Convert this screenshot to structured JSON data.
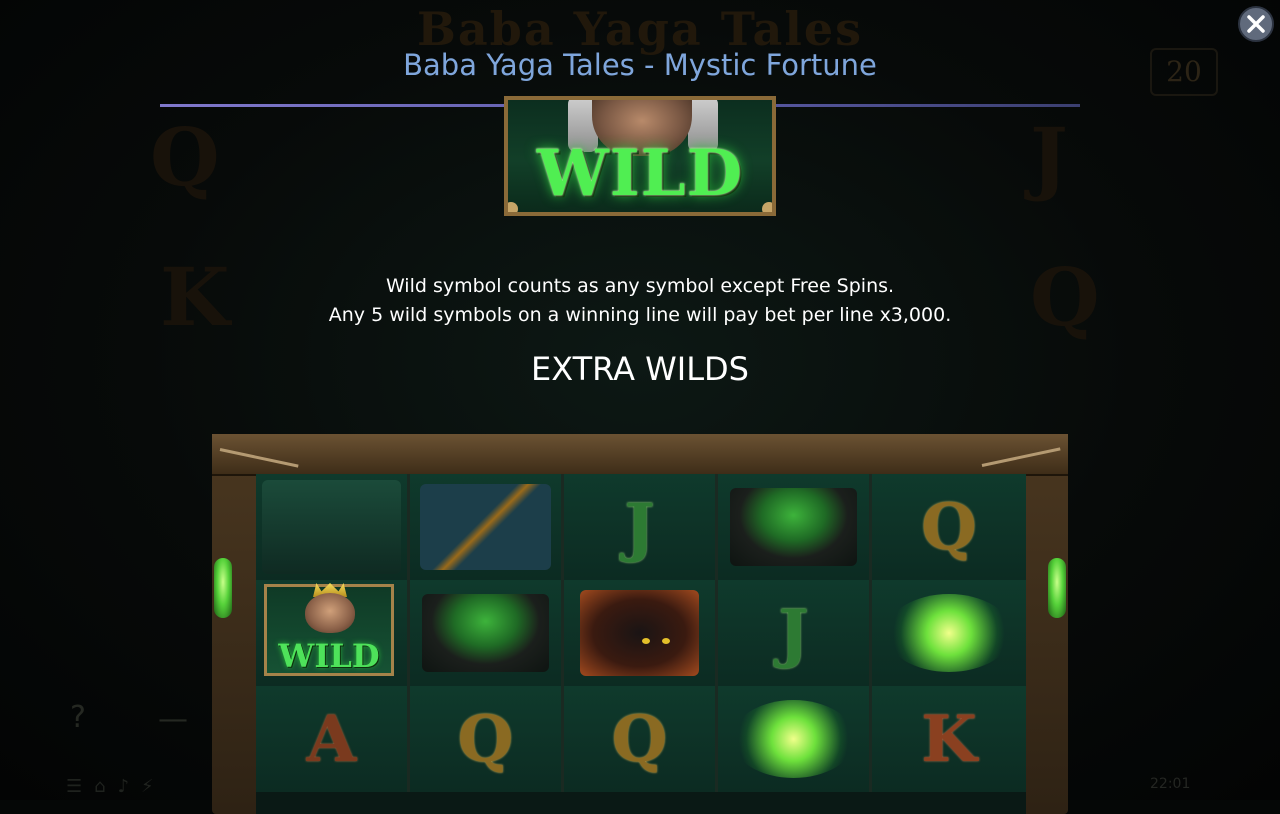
{
  "game": {
    "title": "Baba Yaga Tales - Mystic Fortune",
    "background_title": "Baba Yaga Tales",
    "background_counter": "20",
    "background_help": "?",
    "background_minus": "—",
    "background_time": "22:01"
  },
  "wild_symbol": {
    "label": "WILD",
    "description_lines": [
      "Wild symbol counts as any symbol except Free Spins.",
      "Any 5 wild symbols on a winning line will pay bet per line x3,000."
    ]
  },
  "section": {
    "heading": "EXTRA WILDS"
  },
  "reels": {
    "wild_label": "WILD",
    "letters": {
      "j": "J",
      "q": "Q",
      "a": "A",
      "k": "K"
    }
  },
  "colors": {
    "title": "#7fa6dc",
    "wild_green": "#50ee52",
    "rule": "#8078cc",
    "text": "#ffffff"
  },
  "icons": {
    "close": "close-icon"
  }
}
